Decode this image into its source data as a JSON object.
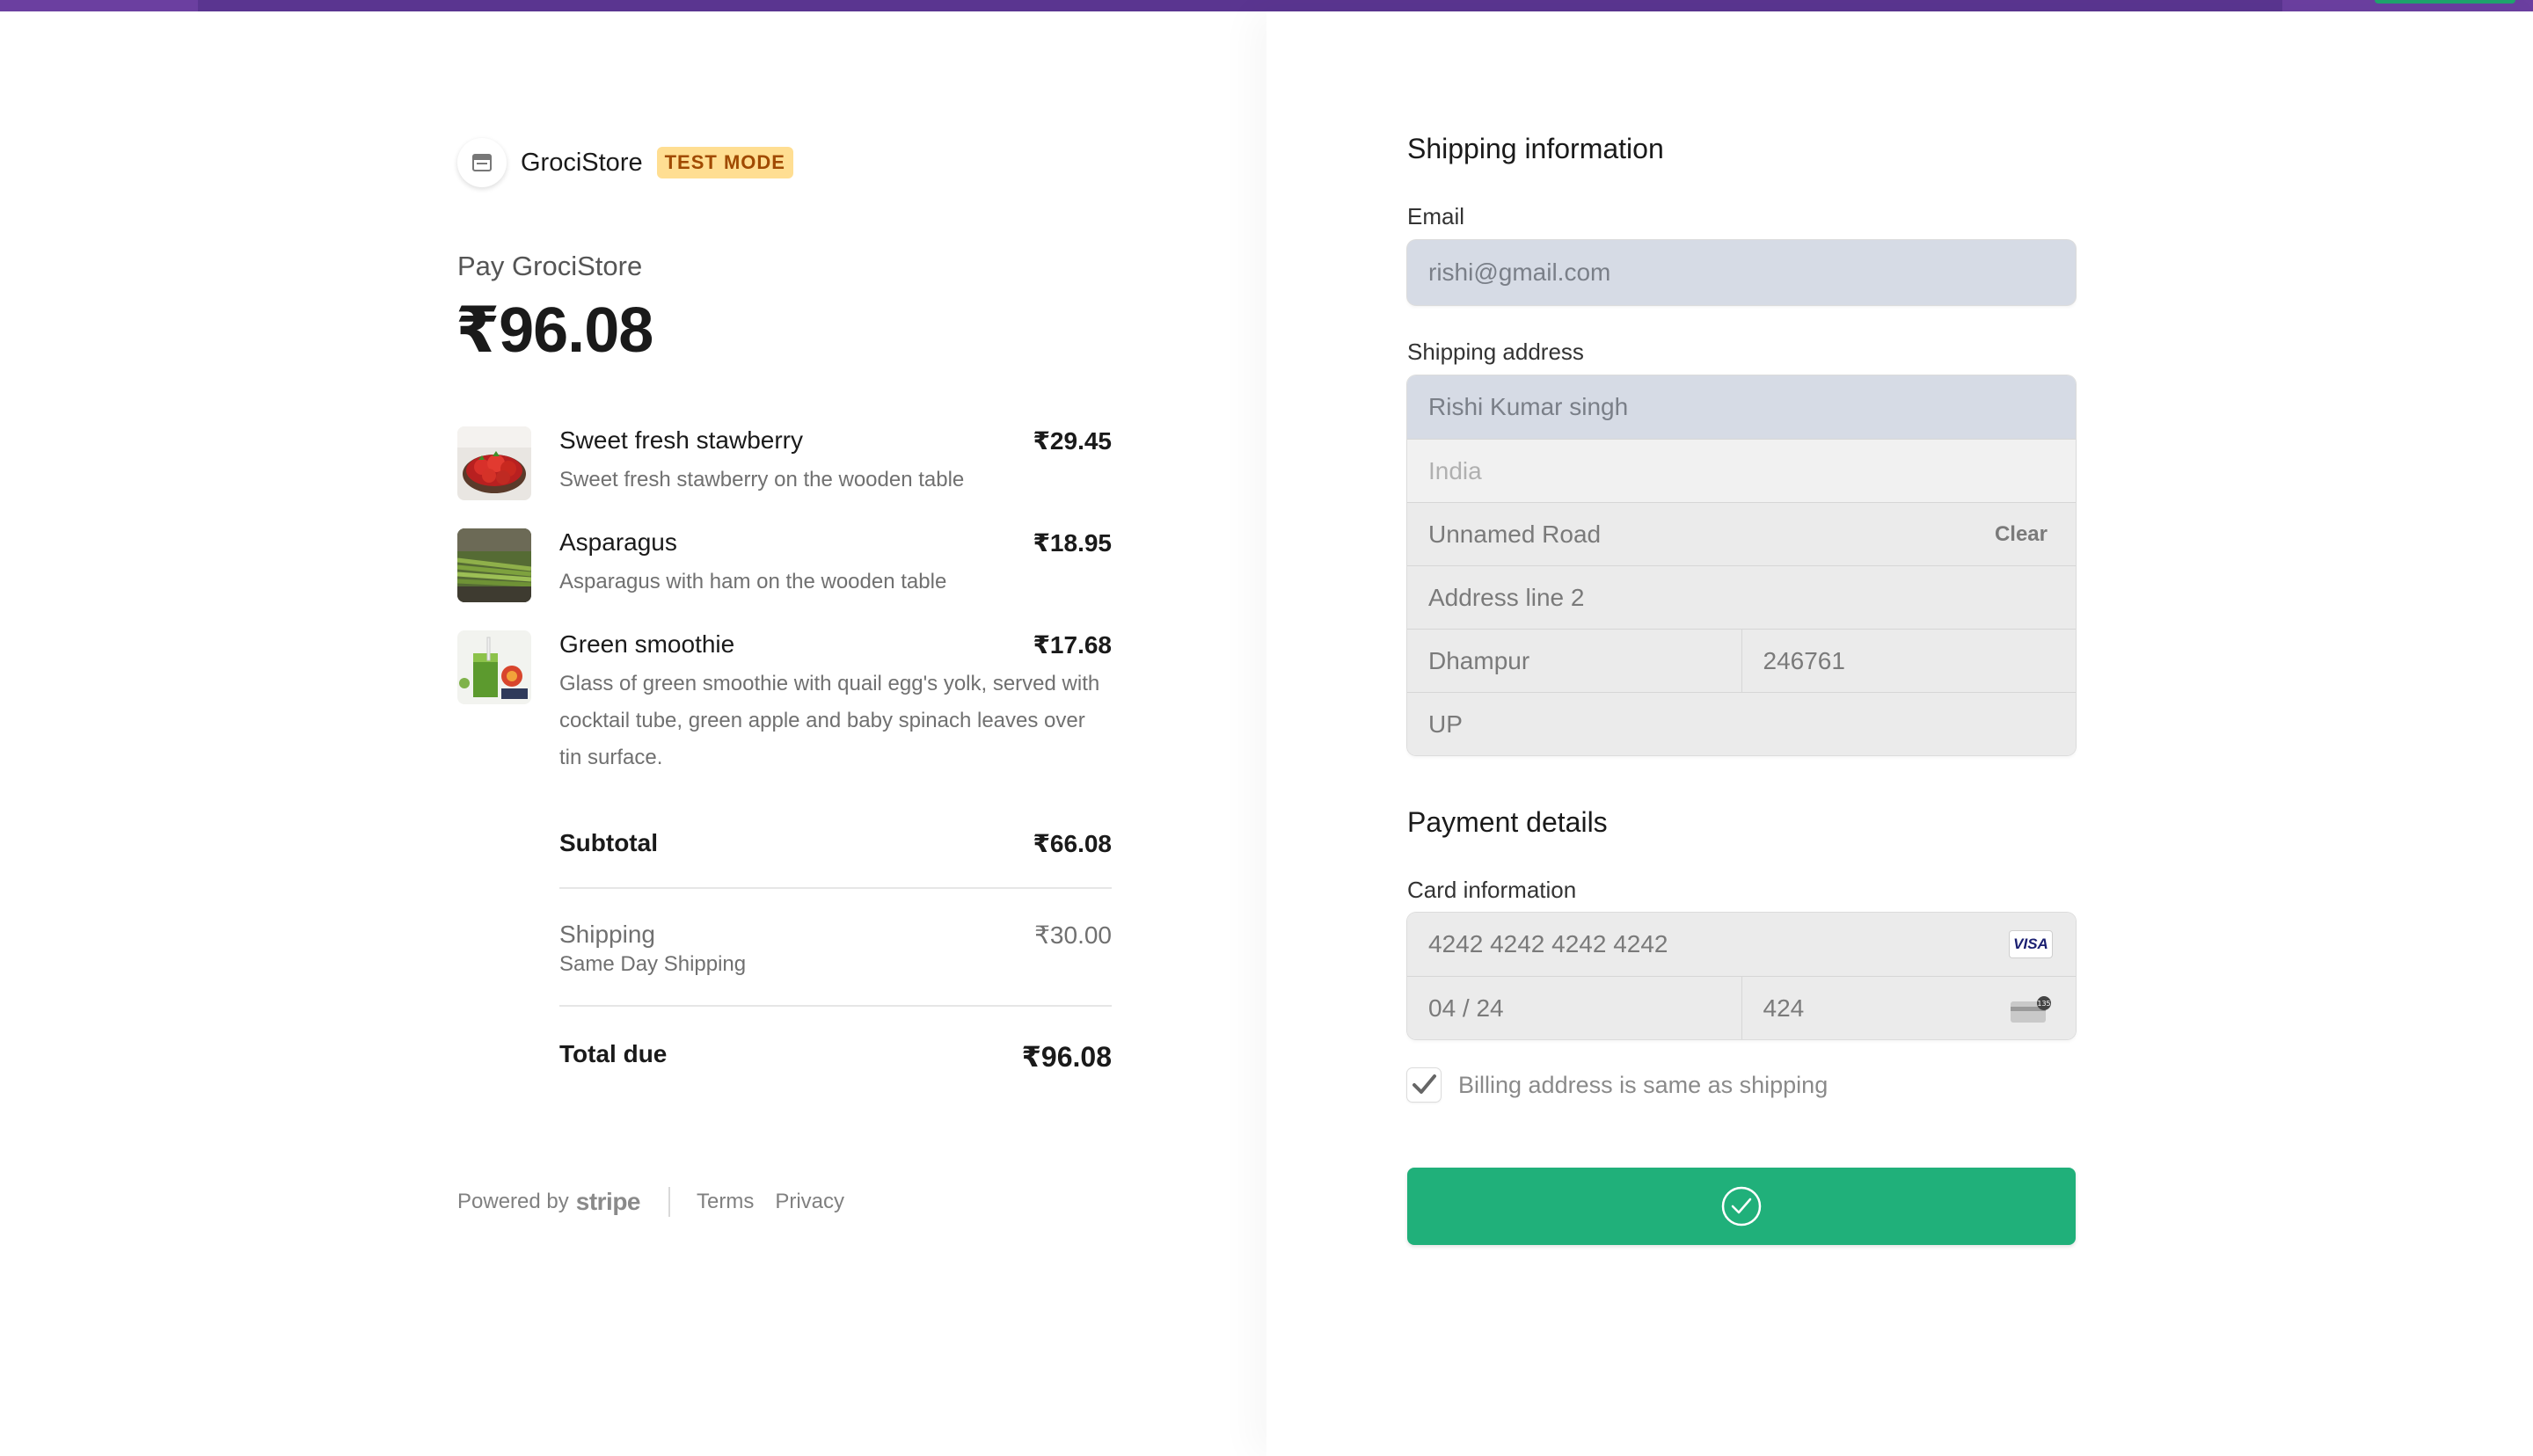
{
  "merchant": {
    "name": "GrociStore",
    "badge": "TEST MODE",
    "logo_icon": "store-icon"
  },
  "summary": {
    "pay_label": "Pay GrociStore",
    "amount": "₹96.08"
  },
  "items": [
    {
      "name": "Sweet fresh stawberry",
      "price": "₹29.45",
      "description": "Sweet fresh stawberry on the wooden table"
    },
    {
      "name": "Asparagus",
      "price": "₹18.95",
      "description": "Asparagus with ham on the wooden table"
    },
    {
      "name": "Green smoothie",
      "price": "₹17.68",
      "description": "Glass of green smoothie with quail egg's yolk, served with cocktail tube, green apple and baby spinach leaves over tin surface."
    }
  ],
  "totals": {
    "subtotal_label": "Subtotal",
    "subtotal_value": "₹66.08",
    "shipping_label": "Shipping",
    "shipping_method": "Same Day Shipping",
    "shipping_value": "₹30.00",
    "total_label": "Total due",
    "total_value": "₹96.08"
  },
  "footer": {
    "powered_by": "Powered by",
    "brand": "stripe",
    "terms": "Terms",
    "privacy": "Privacy"
  },
  "shipping": {
    "title": "Shipping information",
    "email_label": "Email",
    "email_value": "rishi@gmail.com",
    "address_label": "Shipping address",
    "name": "Rishi Kumar singh",
    "country": "India",
    "line1": "Unnamed Road",
    "clear_label": "Clear",
    "line2_placeholder": "Address line 2",
    "city": "Dhampur",
    "postal": "246761",
    "state": "UP"
  },
  "payment": {
    "title": "Payment details",
    "card_label": "Card information",
    "card_number": "4242 4242 4242 4242",
    "card_brand": "VISA",
    "expiry": "04 / 24",
    "cvc": "424",
    "billing_same_label": "Billing address is same as shipping",
    "billing_same_checked": true
  },
  "pay_button": {
    "icon": "check-circle-icon",
    "color": "#20b07a"
  },
  "colors": {
    "topbar": "#6b3fa0",
    "badge_bg": "#ffde92",
    "badge_text": "#a04a00"
  }
}
